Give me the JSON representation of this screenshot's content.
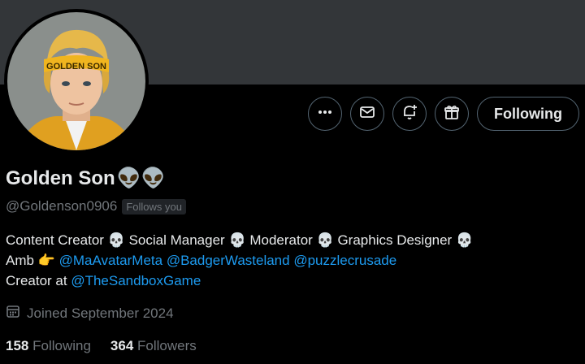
{
  "profile": {
    "avatar_headband_text": "GOLDEN SON",
    "display_name": "Golden Son",
    "name_emoji": "👽👽",
    "handle": "@Goldenson0906",
    "follows_you_badge": "Follows you"
  },
  "actions": {
    "more_icon": "more-icon",
    "message_icon": "mail-icon",
    "notify_icon": "bell-plus-icon",
    "gift_icon": "gift-icon",
    "following_label": "Following"
  },
  "bio": {
    "line1": {
      "p1": "Content Creator ",
      "s1": "💀",
      "p2": " Social Manager ",
      "s2": "💀",
      "p3": " Moderator ",
      "s3": "💀",
      "p4": " Graphics Designer ",
      "s4": "💀"
    },
    "line2": {
      "prefix": "Amb ",
      "pointer": "👉",
      "mention1": "@MaAvatarMeta",
      "mention2": "@BadgerWasteland",
      "mention3": "@puzzlecrusade"
    },
    "line3": {
      "prefix": "Creator at ",
      "mention": "@TheSandboxGame"
    }
  },
  "joined": {
    "icon": "calendar-icon",
    "text": "Joined September 2024"
  },
  "stats": {
    "following_count": "158",
    "following_label": "Following",
    "followers_count": "364",
    "followers_label": "Followers"
  },
  "colors": {
    "background": "#000000",
    "banner": "#333639",
    "text": "#e7e9ea",
    "muted": "#71767b",
    "link": "#1d9bf0",
    "border": "#536471"
  }
}
